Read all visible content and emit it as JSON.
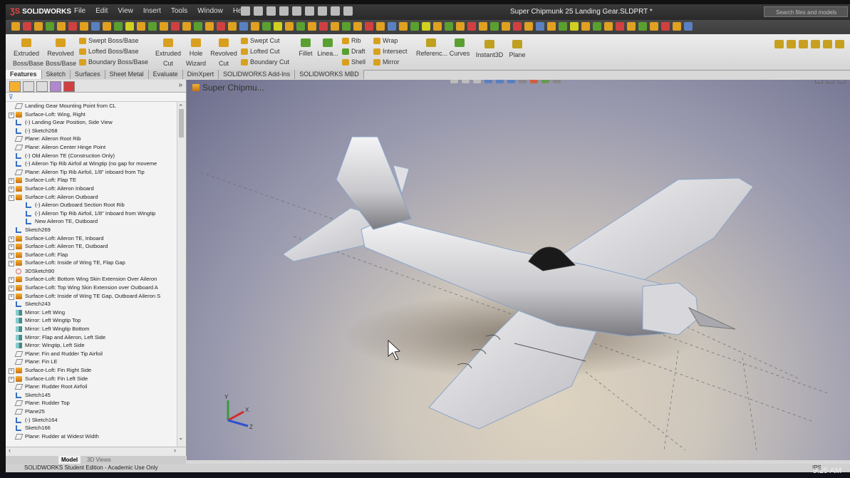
{
  "app": {
    "logo_text": "SOLIDWORKS",
    "window_title": "Super Chipmunk 25 Landing Gear.SLDPRT *",
    "search_placeholder": "Search files and models"
  },
  "menu": [
    "File",
    "Edit",
    "View",
    "Insert",
    "Tools",
    "Window",
    "Help"
  ],
  "command_manager": {
    "big_tools": [
      {
        "name": "extruded-boss",
        "line1": "Extruded",
        "line2": "Boss/Base",
        "color": "#d9a020"
      },
      {
        "name": "revolved-boss",
        "line1": "Revolved",
        "line2": "Boss/Base",
        "color": "#d9a020"
      },
      {
        "name": "extruded-cut",
        "line1": "Extruded",
        "line2": "Cut",
        "color": "#d9a020"
      },
      {
        "name": "hole-wizard",
        "line1": "Hole",
        "line2": "Wizard",
        "color": "#d9a020"
      },
      {
        "name": "revolved-cut",
        "line1": "Revolved",
        "line2": "Cut",
        "color": "#d9a020"
      },
      {
        "name": "fillet",
        "line1": "Fillet",
        "line2": "",
        "color": "#5aa030"
      },
      {
        "name": "linear-pattern",
        "line1": "Linea...",
        "line2": "",
        "color": "#5aa030"
      },
      {
        "name": "reference-geometry",
        "line1": "Referenc...",
        "line2": "",
        "color": "#c0a020"
      },
      {
        "name": "curves",
        "line1": "Curves",
        "line2": "",
        "color": "#5aa030"
      },
      {
        "name": "instant3d",
        "line1": "Instant3D",
        "line2": "",
        "color": "#c0a020"
      },
      {
        "name": "plane",
        "line1": "Plane",
        "line2": "",
        "color": "#c0a020"
      }
    ],
    "boss_stack": [
      "Swept Boss/Base",
      "Lofted Boss/Base",
      "Boundary Boss/Base"
    ],
    "cut_stack": [
      "Swept Cut",
      "Lofted Cut",
      "Boundary Cut"
    ],
    "features_stack_a": [
      "Rib",
      "Draft",
      "Shell"
    ],
    "features_stack_b": [
      "Wrap",
      "Intersect",
      "Mirror"
    ]
  },
  "tabs": [
    "Features",
    "Sketch",
    "Surfaces",
    "Sheet Metal",
    "Evaluate",
    "DimXpert",
    "SOLIDWORKS Add-Ins",
    "SOLIDWORKS MBD"
  ],
  "tree": [
    {
      "label": "Landing Gear Mounting Point from CL",
      "type": "plane",
      "indent": 1
    },
    {
      "label": "Surface-Loft:  Wing, Right",
      "type": "surf",
      "indent": 1,
      "pm": true
    },
    {
      "label": "(-) Landing Gear Position, Side View",
      "type": "sketch",
      "indent": 1
    },
    {
      "label": "(-) Sketch268",
      "type": "sketch",
      "indent": 1
    },
    {
      "label": "Plane:  Aileron Root Rib",
      "type": "plane",
      "indent": 1
    },
    {
      "label": "Plane:  Aileron Center Hinge Point",
      "type": "plane",
      "indent": 1
    },
    {
      "label": "(-) Old Aileron TE (Construction Only)",
      "type": "sketch",
      "indent": 1
    },
    {
      "label": "(-) Aileron Tip Rib Airfoil at Wingtip (no gap for moveme",
      "type": "sketch",
      "indent": 1
    },
    {
      "label": "Plane:  Aileron Tip Rib Airfoil, 1/8\" inboard from Tip",
      "type": "plane",
      "indent": 1
    },
    {
      "label": "Surface-Loft:  Flap TE",
      "type": "surf",
      "indent": 1,
      "pm": true
    },
    {
      "label": "Surface-Loft:  Aileron Inboard",
      "type": "surf",
      "indent": 1,
      "pm": true
    },
    {
      "label": "Surface-Loft:  Aileron Outboard",
      "type": "surf",
      "indent": 1,
      "pm": true
    },
    {
      "label": "(-) Aileron Outboard Section Root Rib",
      "type": "sketch",
      "indent": 2
    },
    {
      "label": "(-) Aileron Tip Rib Airfoil, 1/8\" Inboard from Wingtip",
      "type": "sketch",
      "indent": 2
    },
    {
      "label": "New Aileron TE, Outboard",
      "type": "sketch",
      "indent": 2
    },
    {
      "label": "Sketch269",
      "type": "sketch",
      "indent": 1
    },
    {
      "label": "Surface-Loft:  Aileron TE, Inboard",
      "type": "surf",
      "indent": 1,
      "pm": true
    },
    {
      "label": "Surface-Loft:  Aileron TE, Outboard",
      "type": "surf",
      "indent": 1,
      "pm": true
    },
    {
      "label": "Surface-Loft:  Flap",
      "type": "surf",
      "indent": 1,
      "pm": true
    },
    {
      "label": "Surface-Loft:  Inside of Wing TE, Flap Gap",
      "type": "surf",
      "indent": 1,
      "pm": true
    },
    {
      "label": "3DSketch90",
      "type": "sk3d",
      "indent": 1
    },
    {
      "label": "Surface-Loft:  Bottom Wing Skin Extension Over Aileron",
      "type": "surf",
      "indent": 1,
      "pm": true
    },
    {
      "label": "Surface-Loft:  Top Wing Skin Extension over Outboard A",
      "type": "surf",
      "indent": 1,
      "pm": true
    },
    {
      "label": "Surface-Loft:  Inside of Wing TE Gap, Outboard Aileron S",
      "type": "surf",
      "indent": 1,
      "pm": true
    },
    {
      "label": "Sketch243",
      "type": "sketch",
      "indent": 1
    },
    {
      "label": "Mirror:  Left Wing",
      "type": "mirror",
      "indent": 1
    },
    {
      "label": "Mirror:  Left Wingtip Top",
      "type": "mirror",
      "indent": 1
    },
    {
      "label": "Mirror:  Left Wingtip Bottom",
      "type": "mirror",
      "indent": 1
    },
    {
      "label": "Mirror:  Flap and Aileron, Left Side",
      "type": "mirror",
      "indent": 1
    },
    {
      "label": "Mirror:  Wingtip, Left Side",
      "type": "mirror",
      "indent": 1
    },
    {
      "label": "Plane:  Fin and Rudder Tip Airfoil",
      "type": "plane",
      "indent": 1
    },
    {
      "label": "Plane:  Fin LE",
      "type": "plane",
      "indent": 1
    },
    {
      "label": "Surface-Loft:  Fin Right Side",
      "type": "surf",
      "indent": 1,
      "pm": true
    },
    {
      "label": "Surface-Loft:  Fin Left Side",
      "type": "surf",
      "indent": 1,
      "pm": true
    },
    {
      "label": "Plane:  Rudder Root Airfoil",
      "type": "plane",
      "indent": 1
    },
    {
      "label": "Sketch145",
      "type": "sketch",
      "indent": 1
    },
    {
      "label": "Plane:  Rudder Top",
      "type": "plane",
      "indent": 1
    },
    {
      "label": "Plane25",
      "type": "plane",
      "indent": 1
    },
    {
      "label": "(-) Sketch164",
      "type": "sketch",
      "indent": 1
    },
    {
      "label": "Sketch166",
      "type": "sketch",
      "indent": 1
    },
    {
      "label": "Plane:  Rudder at Widest Width",
      "type": "plane",
      "indent": 1
    }
  ],
  "viewport": {
    "title": "Super Chipmu..."
  },
  "bottom_tabs": [
    "Model",
    "3D Views"
  ],
  "status": {
    "text": "SOLIDWORKS Student Edition - Academic Use Only",
    "units": "IPS"
  },
  "clock": "9:25 AM"
}
